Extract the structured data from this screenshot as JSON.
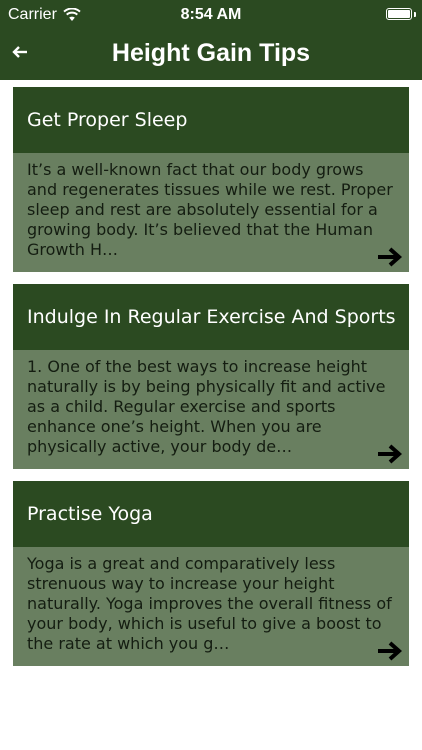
{
  "status_bar": {
    "carrier": "Carrier",
    "time": "8:54 AM",
    "wifi_icon": "wifi-icon",
    "battery_icon": "battery-icon"
  },
  "nav": {
    "back_icon": "arrow-left-icon",
    "title": "Height Gain Tips"
  },
  "colors": {
    "header_bg": "#2b4a21",
    "card_header_bg": "#2b4a21",
    "card_body_bg": "#697f60",
    "card_text": "#141d11",
    "background": "#ffffff"
  },
  "cards": [
    {
      "title": "Get Proper Sleep",
      "text": "It’s a well-known fact that our body grows and regenerates tissues while we rest. Proper sleep and rest are absolutely essential for a growing body. It’s believed that the Human Growth H…",
      "arrow_icon": "arrow-right-icon"
    },
    {
      "title": "Indulge In Regular Exercise And Sports",
      "text": "1. One of the best ways to increase height naturally is by being physically fit and active as a child. Regular exercise and sports enhance one’s height. When you are physically active, your body de…",
      "arrow_icon": "arrow-right-icon"
    },
    {
      "title": "Practise Yoga",
      "text": "Yoga is a great and comparatively less strenuous way to increase your height naturally. Yoga improves the overall fitness of your body, which is useful to give a boost to the rate at which you g…",
      "arrow_icon": "arrow-right-icon"
    }
  ]
}
